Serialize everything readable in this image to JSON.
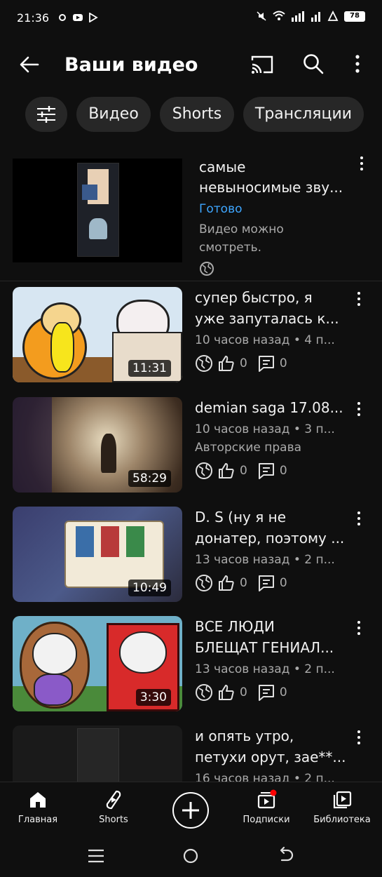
{
  "status_bar": {
    "time": "21:36",
    "battery": "78"
  },
  "header": {
    "title": "Ваши видео"
  },
  "chips": [
    "Видео",
    "Shorts",
    "Трансляции"
  ],
  "first_item": {
    "title_line1": "самые",
    "title_line2": "невыносимые зву...",
    "status": "Готово",
    "note_line1": "Видео можно",
    "note_line2": "смотреть."
  },
  "videos": [
    {
      "title_line1": "супер быстро, я",
      "title_line2": "уже запуталась к...",
      "meta": "10 часов назад • 4 п...",
      "duration": "11:31",
      "likes": "0",
      "comments": "0"
    },
    {
      "title_line1": "demian saga 17.08...",
      "title_line2": "",
      "meta": "10 часов назад • 3 п...",
      "extra": "Авторские права",
      "duration": "58:29",
      "likes": "0",
      "comments": "0"
    },
    {
      "title_line1": "D. S (ну я не",
      "title_line2": "донатер, поэтому ...",
      "meta": "13 часов назад • 2 п...",
      "duration": "10:49",
      "likes": "0",
      "comments": "0"
    },
    {
      "title_line1": "ВСЕ ЛЮДИ",
      "title_line2": "БЛЕЩАТ ГЕНИАЛ...",
      "meta": "13 часов назад • 2 п...",
      "duration": "3:30",
      "likes": "0",
      "comments": "0"
    },
    {
      "title_line1": "и опять утро,",
      "title_line2": "петухи орут, зае**...",
      "meta": "16 часов назад • 2 п...",
      "duration": "",
      "likes": "",
      "comments": ""
    }
  ],
  "bottom_nav": {
    "home": "Главная",
    "shorts": "Shorts",
    "subscriptions": "Подписки",
    "library": "Библиотека"
  },
  "colors": {
    "background": "#0f0f0f",
    "chip": "#272727",
    "link_blue": "#3ea6ff",
    "secondary_text": "#aaaaaa",
    "badge_red": "#ff0000"
  }
}
